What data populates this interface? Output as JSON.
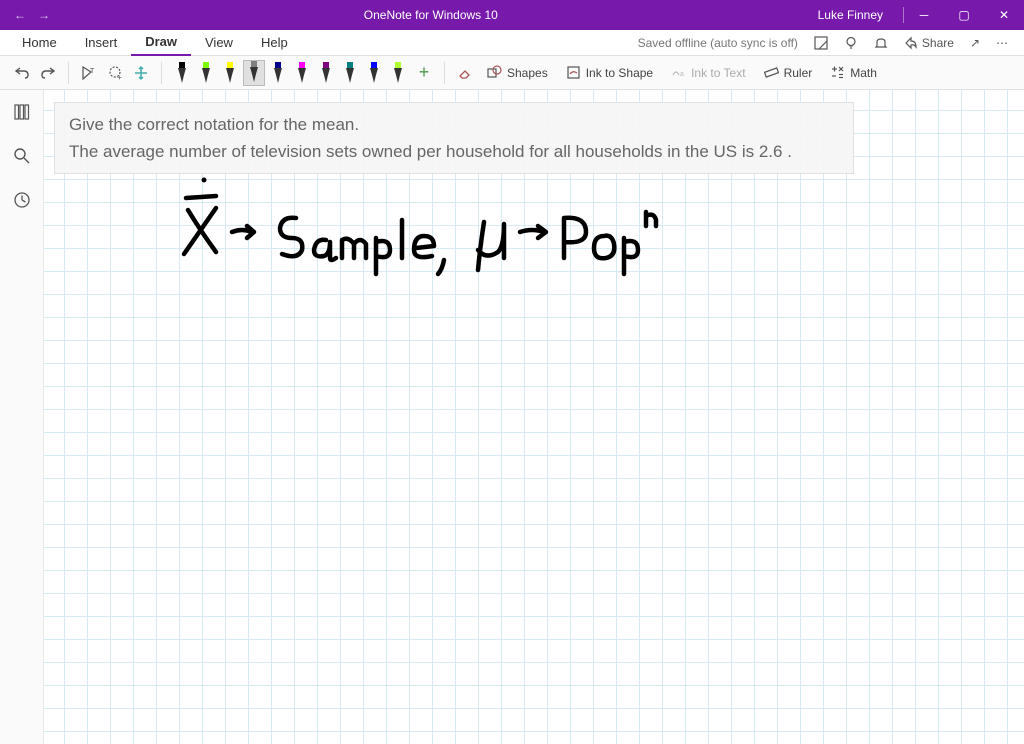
{
  "titlebar": {
    "title": "OneNote for Windows 10",
    "user": "Luke Finney"
  },
  "ribbon": {
    "tabs": {
      "home": "Home",
      "insert": "Insert",
      "draw": "Draw",
      "view": "View",
      "help": "Help"
    },
    "active_tab": "draw",
    "autosave": "Saved offline (auto sync is off)",
    "share": "Share"
  },
  "toolbar": {
    "shapes": "Shapes",
    "ink_to_shape": "Ink to Shape",
    "ink_to_text": "Ink to Text",
    "ruler": "Ruler",
    "math": "Math",
    "pens": [
      {
        "type": "pen",
        "color": "#000000"
      },
      {
        "type": "hl",
        "color": "#7CFC00"
      },
      {
        "type": "hl",
        "color": "#FFFF00"
      },
      {
        "type": "hl",
        "color": "#808080",
        "selected": true
      },
      {
        "type": "hl",
        "color": "#00008B"
      },
      {
        "type": "hl",
        "color": "#FF00FF"
      },
      {
        "type": "hl",
        "color": "#800080"
      },
      {
        "type": "hl",
        "color": "#008080"
      },
      {
        "type": "hl",
        "color": "#0000FF"
      },
      {
        "type": "hl",
        "color": "#ADFF2F"
      }
    ]
  },
  "note": {
    "line1": "Give the correct notation for the mean.",
    "line2": "The average number of television sets owned per household for all households in the US is 2.6 ."
  },
  "colors": {
    "brand": "#7719AA"
  }
}
